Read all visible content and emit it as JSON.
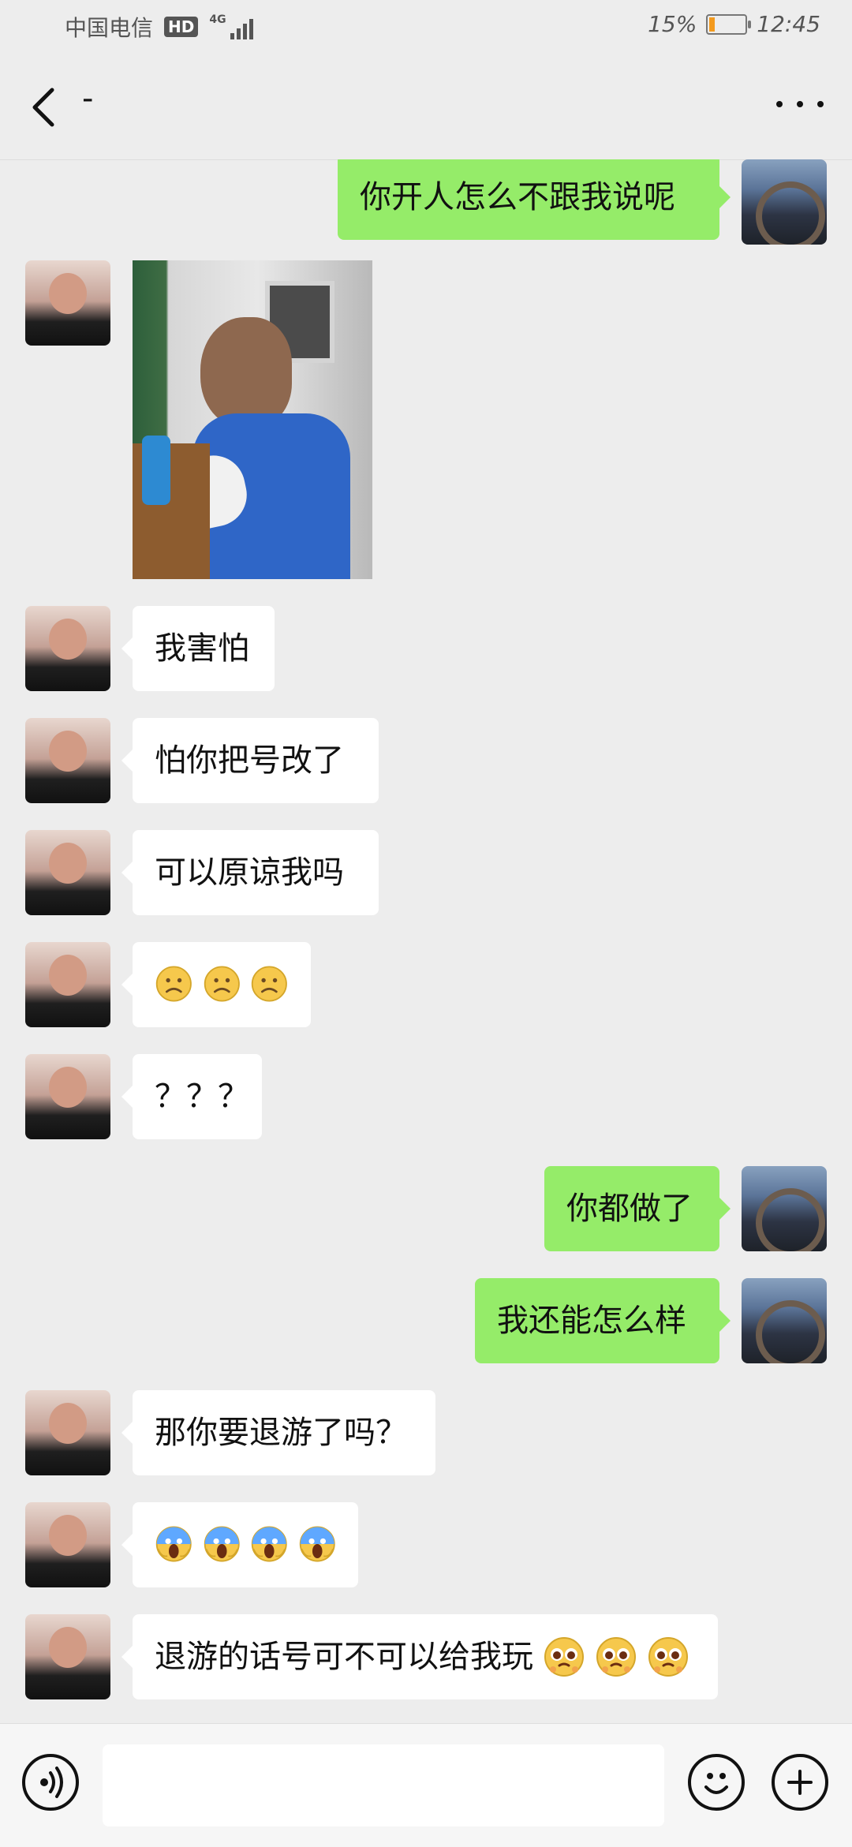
{
  "status_bar": {
    "carrier": "中国电信",
    "hd_label": "HD",
    "network_label": "4G",
    "battery_percent": "15%",
    "battery_level": 0.15,
    "time": "12:45"
  },
  "header": {
    "title": "-"
  },
  "messages": [
    {
      "side": "right",
      "type": "text",
      "text": "你开人怎么不跟我说呢"
    },
    {
      "side": "left",
      "type": "image"
    },
    {
      "side": "left",
      "type": "text",
      "text": "我害怕"
    },
    {
      "side": "left",
      "type": "text",
      "text": "怕你把号改了"
    },
    {
      "side": "left",
      "type": "text",
      "text": "可以原谅我吗"
    },
    {
      "side": "left",
      "type": "emoji",
      "emoji_names": [
        "frown-emoji",
        "frown-emoji",
        "frown-emoji"
      ]
    },
    {
      "side": "left",
      "type": "text",
      "text": "？？？"
    },
    {
      "side": "right",
      "type": "text",
      "text": "你都做了"
    },
    {
      "side": "right",
      "type": "text",
      "text": "我还能怎么样"
    },
    {
      "side": "left",
      "type": "text",
      "text": "那你要退游了吗？"
    },
    {
      "side": "left",
      "type": "emoji",
      "emoji_names": [
        "scream-emoji",
        "scream-emoji",
        "scream-emoji",
        "scream-emoji"
      ]
    },
    {
      "side": "left",
      "type": "text_with_emoji",
      "text": "退游的话号可不可以给我玩",
      "emoji_names": [
        "pleading-emoji",
        "pleading-emoji",
        "pleading-emoji"
      ]
    }
  ],
  "composer": {
    "input_value": ""
  },
  "colors": {
    "chat_bg": "#ededed",
    "left_bubble": "#ffffff",
    "right_bubble": "#95ec69",
    "battery_fill": "#f39a1e"
  }
}
